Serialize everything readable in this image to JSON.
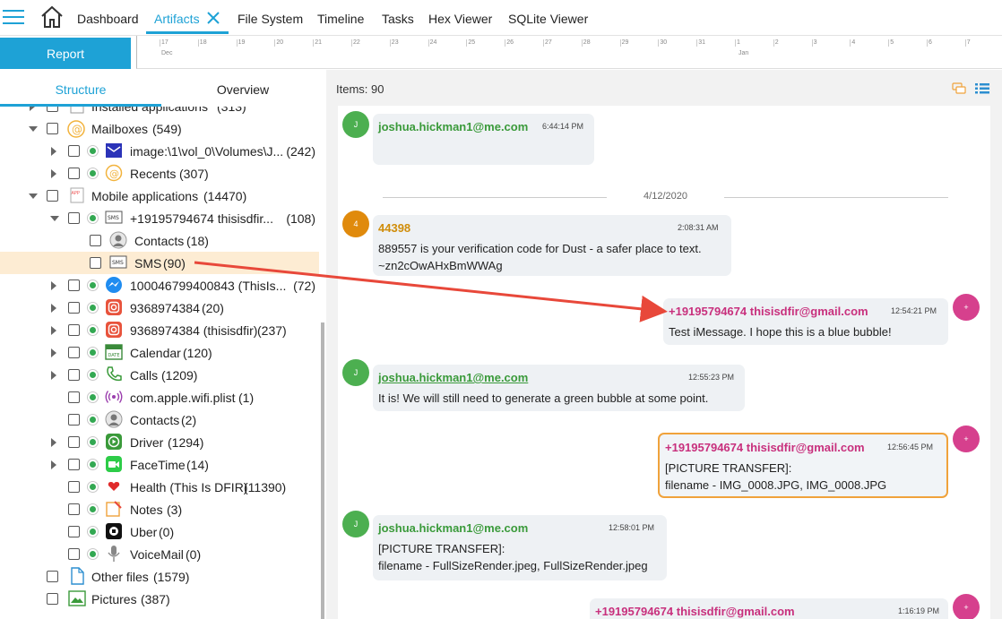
{
  "nav": {
    "tabs": [
      {
        "label": "Dashboard"
      },
      {
        "label": "Artifacts"
      },
      {
        "label": "File System"
      },
      {
        "label": "Timeline"
      },
      {
        "label": "Tasks"
      },
      {
        "label": "Hex Viewer"
      },
      {
        "label": "SQLite Viewer"
      }
    ],
    "active_tab": "Artifacts"
  },
  "toolbar": {
    "report_label": "Report"
  },
  "timeline": {
    "ticks": [
      "17",
      "18",
      "19",
      "20",
      "21",
      "22",
      "23",
      "24",
      "25",
      "26",
      "27",
      "28",
      "29",
      "30",
      "31",
      "1",
      "2",
      "3",
      "4",
      "5",
      "6",
      "7"
    ],
    "month_labels": [
      "Dec",
      "Jan"
    ]
  },
  "left": {
    "tabs": [
      {
        "label": "Structure"
      },
      {
        "label": "Overview"
      }
    ],
    "active_tab": "Structure",
    "tree": [
      {
        "label": "Installed applications",
        "count": "(313)",
        "icon": "app-icon"
      },
      {
        "label": "Mailboxes",
        "count": "(549)",
        "icon": "at-icon"
      },
      {
        "label": "image:\\1\\vol_0\\Volumes\\J...",
        "count": "(242)",
        "icon": "mail-icon"
      },
      {
        "label": "Recents",
        "count": "(307)",
        "icon": "at-icon"
      },
      {
        "label": "Mobile applications",
        "count": "(14470)",
        "icon": "app-icon"
      },
      {
        "label": "+19195794674 thisisdfir...",
        "count": "(108)",
        "icon": "sms-icon"
      },
      {
        "label": "Contacts",
        "count": "(18)",
        "icon": "contact-icon"
      },
      {
        "label": "SMS",
        "count": "(90)",
        "icon": "sms-icon"
      },
      {
        "label": "100046799400843 (ThisIs...",
        "count": "(72)",
        "icon": "messenger-icon"
      },
      {
        "label": "9368974384",
        "count": "(20)",
        "icon": "instagram-icon"
      },
      {
        "label": "9368974384 (thisisdfir)",
        "count": "(237)",
        "icon": "instagram-icon"
      },
      {
        "label": "Calendar",
        "count": "(120)",
        "icon": "calendar-icon"
      },
      {
        "label": "Calls",
        "count": "(1209)",
        "icon": "phone-icon"
      },
      {
        "label": "com.apple.wifi.plist",
        "count": "(1)",
        "icon": "wifi-icon"
      },
      {
        "label": "Contacts",
        "count": "(2)",
        "icon": "contact-icon"
      },
      {
        "label": "Driver",
        "count": "(1294)",
        "icon": "driver-icon"
      },
      {
        "label": "FaceTime",
        "count": "(14)",
        "icon": "facetime-icon"
      },
      {
        "label": "Health (This Is DFIR)",
        "count": "(11390)",
        "icon": "health-icon"
      },
      {
        "label": "Notes",
        "count": "(3)",
        "icon": "notes-icon"
      },
      {
        "label": "Uber",
        "count": "(0)",
        "icon": "uber-icon"
      },
      {
        "label": "VoiceMail",
        "count": "(0)",
        "icon": "microphone-icon"
      },
      {
        "label": "Other files",
        "count": "(1579)",
        "icon": "file-icon"
      },
      {
        "label": "Pictures",
        "count": "(387)",
        "icon": "picture-icon"
      }
    ]
  },
  "right": {
    "items_label": "Items: 90",
    "date_separator": "4/12/2020",
    "messages": [
      {
        "avatar": "J",
        "sender": "joshua.hickman1@me.com",
        "time": "6:44:14 PM",
        "text": ""
      },
      {
        "avatar": "4",
        "sender": "44398",
        "time": "2:08:31 AM",
        "text": "889557 is your verification code for Dust - a safer place to text.",
        "text2": "~zn2cOwAHxBmWWAg"
      },
      {
        "avatar": "+",
        "sender": "+19195794674 thisisdfir@gmail.com",
        "time": "12:54:21 PM",
        "text": "Test iMessage. I hope this is a blue bubble!"
      },
      {
        "avatar": "J",
        "sender": "joshua.hickman1@me.com",
        "time": "12:55:23 PM",
        "text": "It is!  We will still need to generate a green bubble at some point."
      },
      {
        "avatar": "+",
        "sender": "+19195794674 thisisdfir@gmail.com",
        "time": "12:56:45 PM",
        "text": "[PICTURE TRANSFER]:",
        "text2": "filename - IMG_0008.JPG, IMG_0008.JPG"
      },
      {
        "avatar": "J",
        "sender": "joshua.hickman1@me.com",
        "time": "12:58:01 PM",
        "text": "[PICTURE TRANSFER]:",
        "text2": "filename - FullSizeRender.jpeg, FullSizeRender.jpeg"
      },
      {
        "avatar": "+",
        "sender": "+19195794674 thisisdfir@gmail.com",
        "time": "1:16:19 PM",
        "text": ""
      }
    ]
  },
  "colors": {
    "accent": "#1ea2d6",
    "selection": "#fdecd3",
    "highlight_border": "#f0a23b",
    "arrow": "#e8483a",
    "sender_green": "#3a9a3a",
    "sender_pink": "#c8307d",
    "sender_orange": "#d08d0a"
  }
}
